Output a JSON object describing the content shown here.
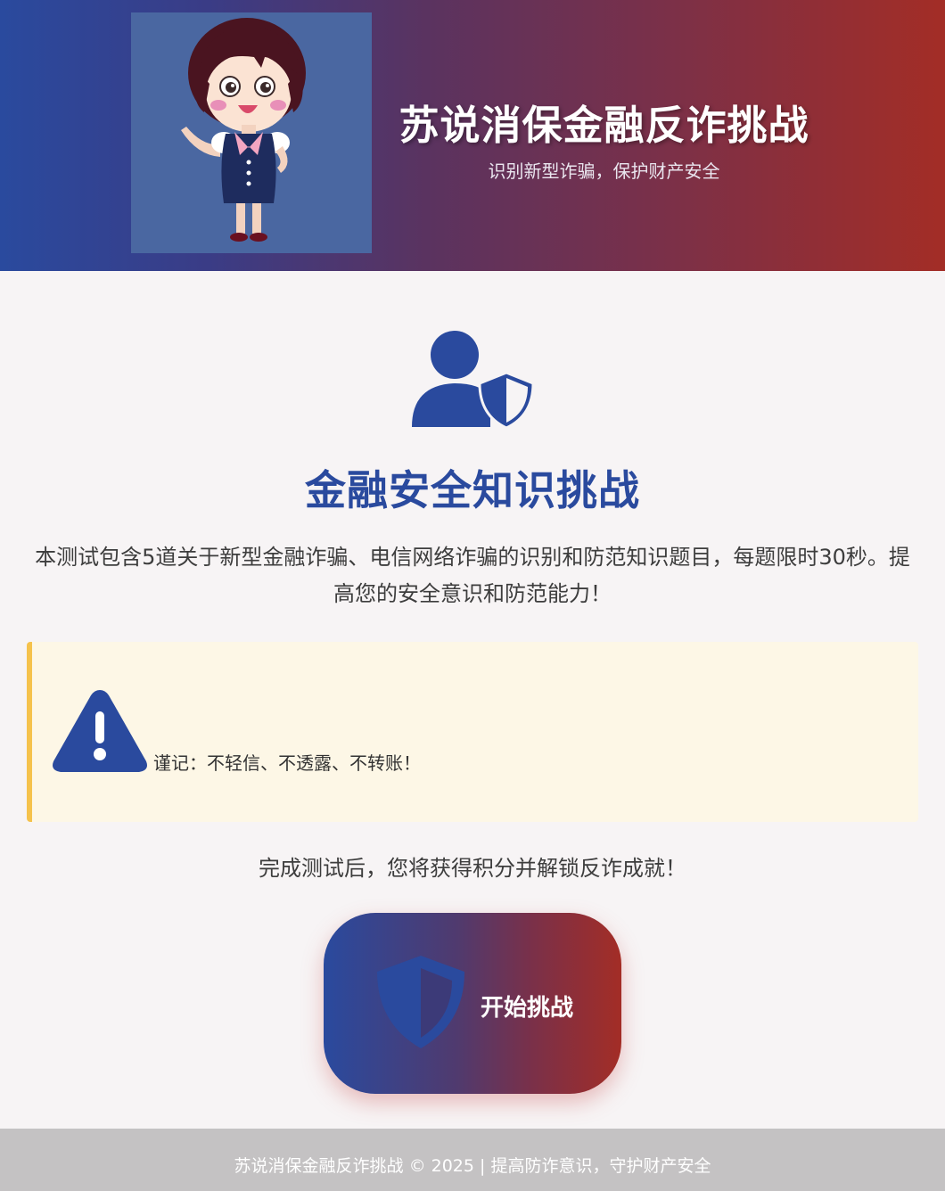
{
  "header": {
    "title": "苏说消保金融反诈挑战",
    "subtitle": "识别新型诈骗，保护财产安全",
    "mascot_icon": "cartoon-bank-staff-girl"
  },
  "main": {
    "hero_icon": "user-shield-icon",
    "title": "金融安全知识挑战",
    "intro": "本测试包含5道关于新型金融诈骗、电信网络诈骗的识别和防范知识题目，每题限时30秒。提高您的安全意识和防范能力！",
    "warning": {
      "icon": "warning-triangle-icon",
      "text": "谨记：不轻信、不透露、不转账！"
    },
    "completion_note": "完成测试后，您将获得积分并解锁反诈成就！",
    "start_button": {
      "label": "开始挑战",
      "icon": "shield-icon"
    }
  },
  "footer": {
    "text": "苏说消保金融反诈挑战 © 2025 | 提高防诈意识，守护财产安全"
  },
  "colors": {
    "primary": "#2a4a9e",
    "accent_red": "#a32d26",
    "warning_border": "#f5c24c",
    "warning_bg": "#fdf7e6",
    "footer_bg": "#c4c2c3"
  }
}
